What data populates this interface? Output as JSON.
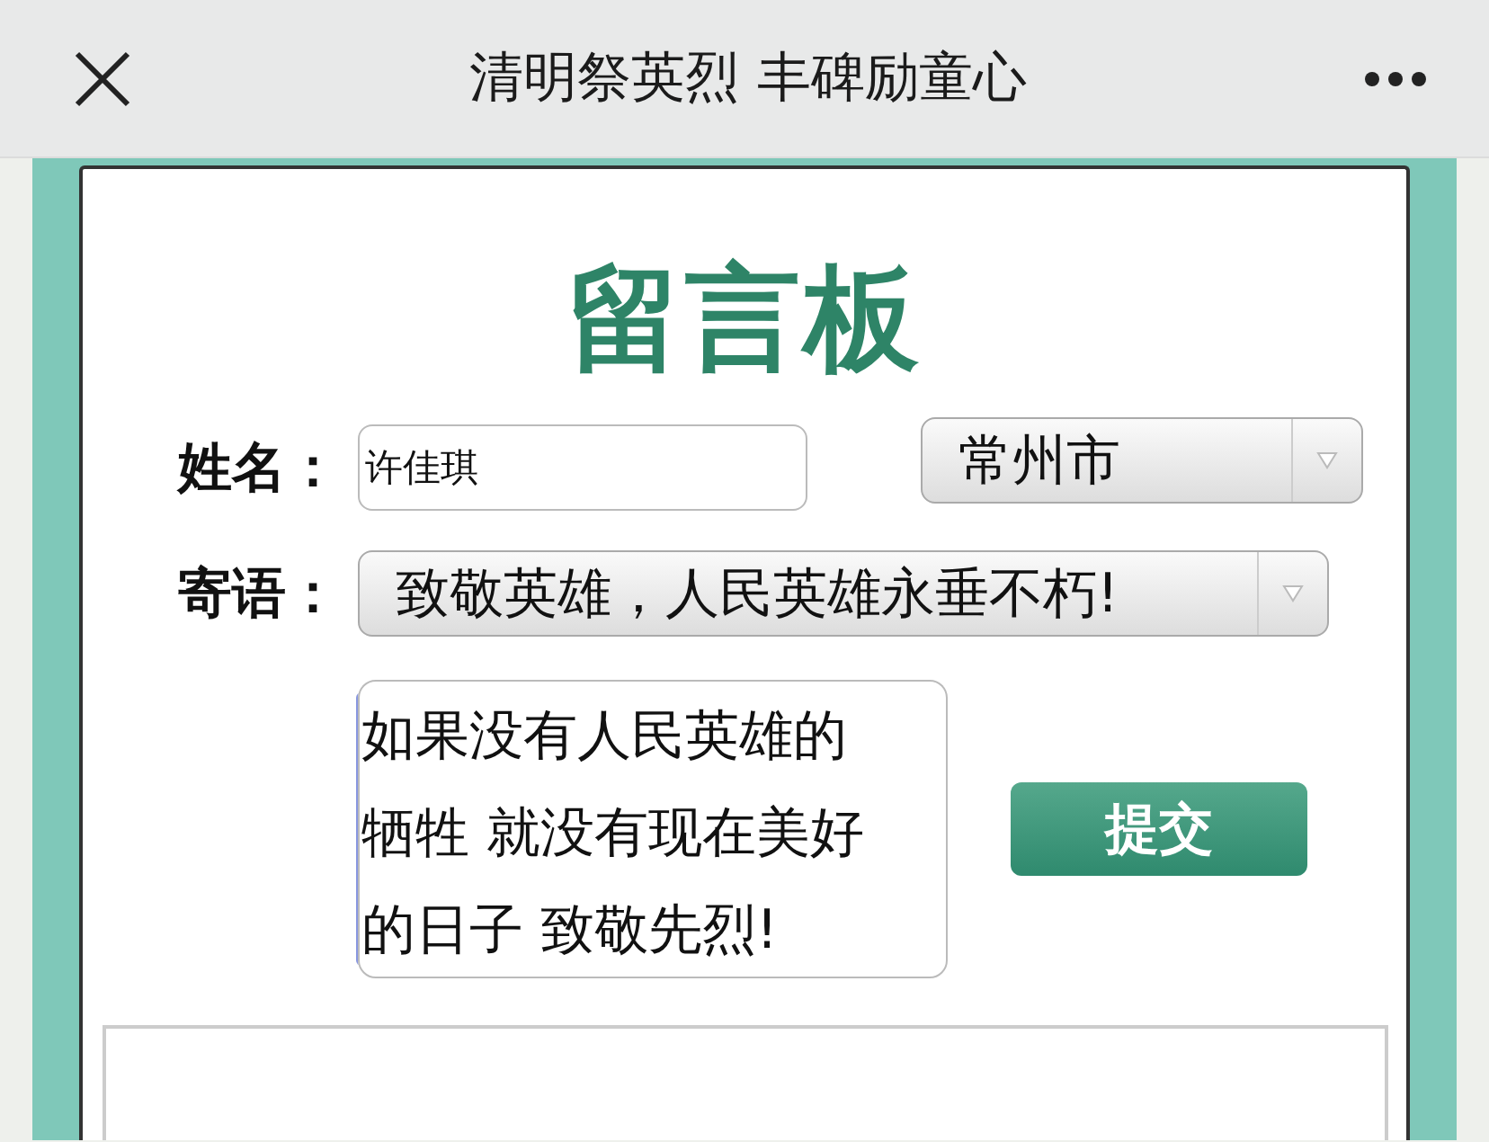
{
  "header": {
    "title": "清明祭英烈 丰碑励童心"
  },
  "board": {
    "title": "留言板",
    "name_label": "姓名：",
    "name_value": "许佳琪",
    "city": "常州市",
    "message_label": "寄语：",
    "preset": "致敬英雄，人民英雄永垂不朽!",
    "message": "如果没有人民英雄的牺牲 就没有现在美好的日子 致敬先烈!",
    "submit": "提交"
  }
}
